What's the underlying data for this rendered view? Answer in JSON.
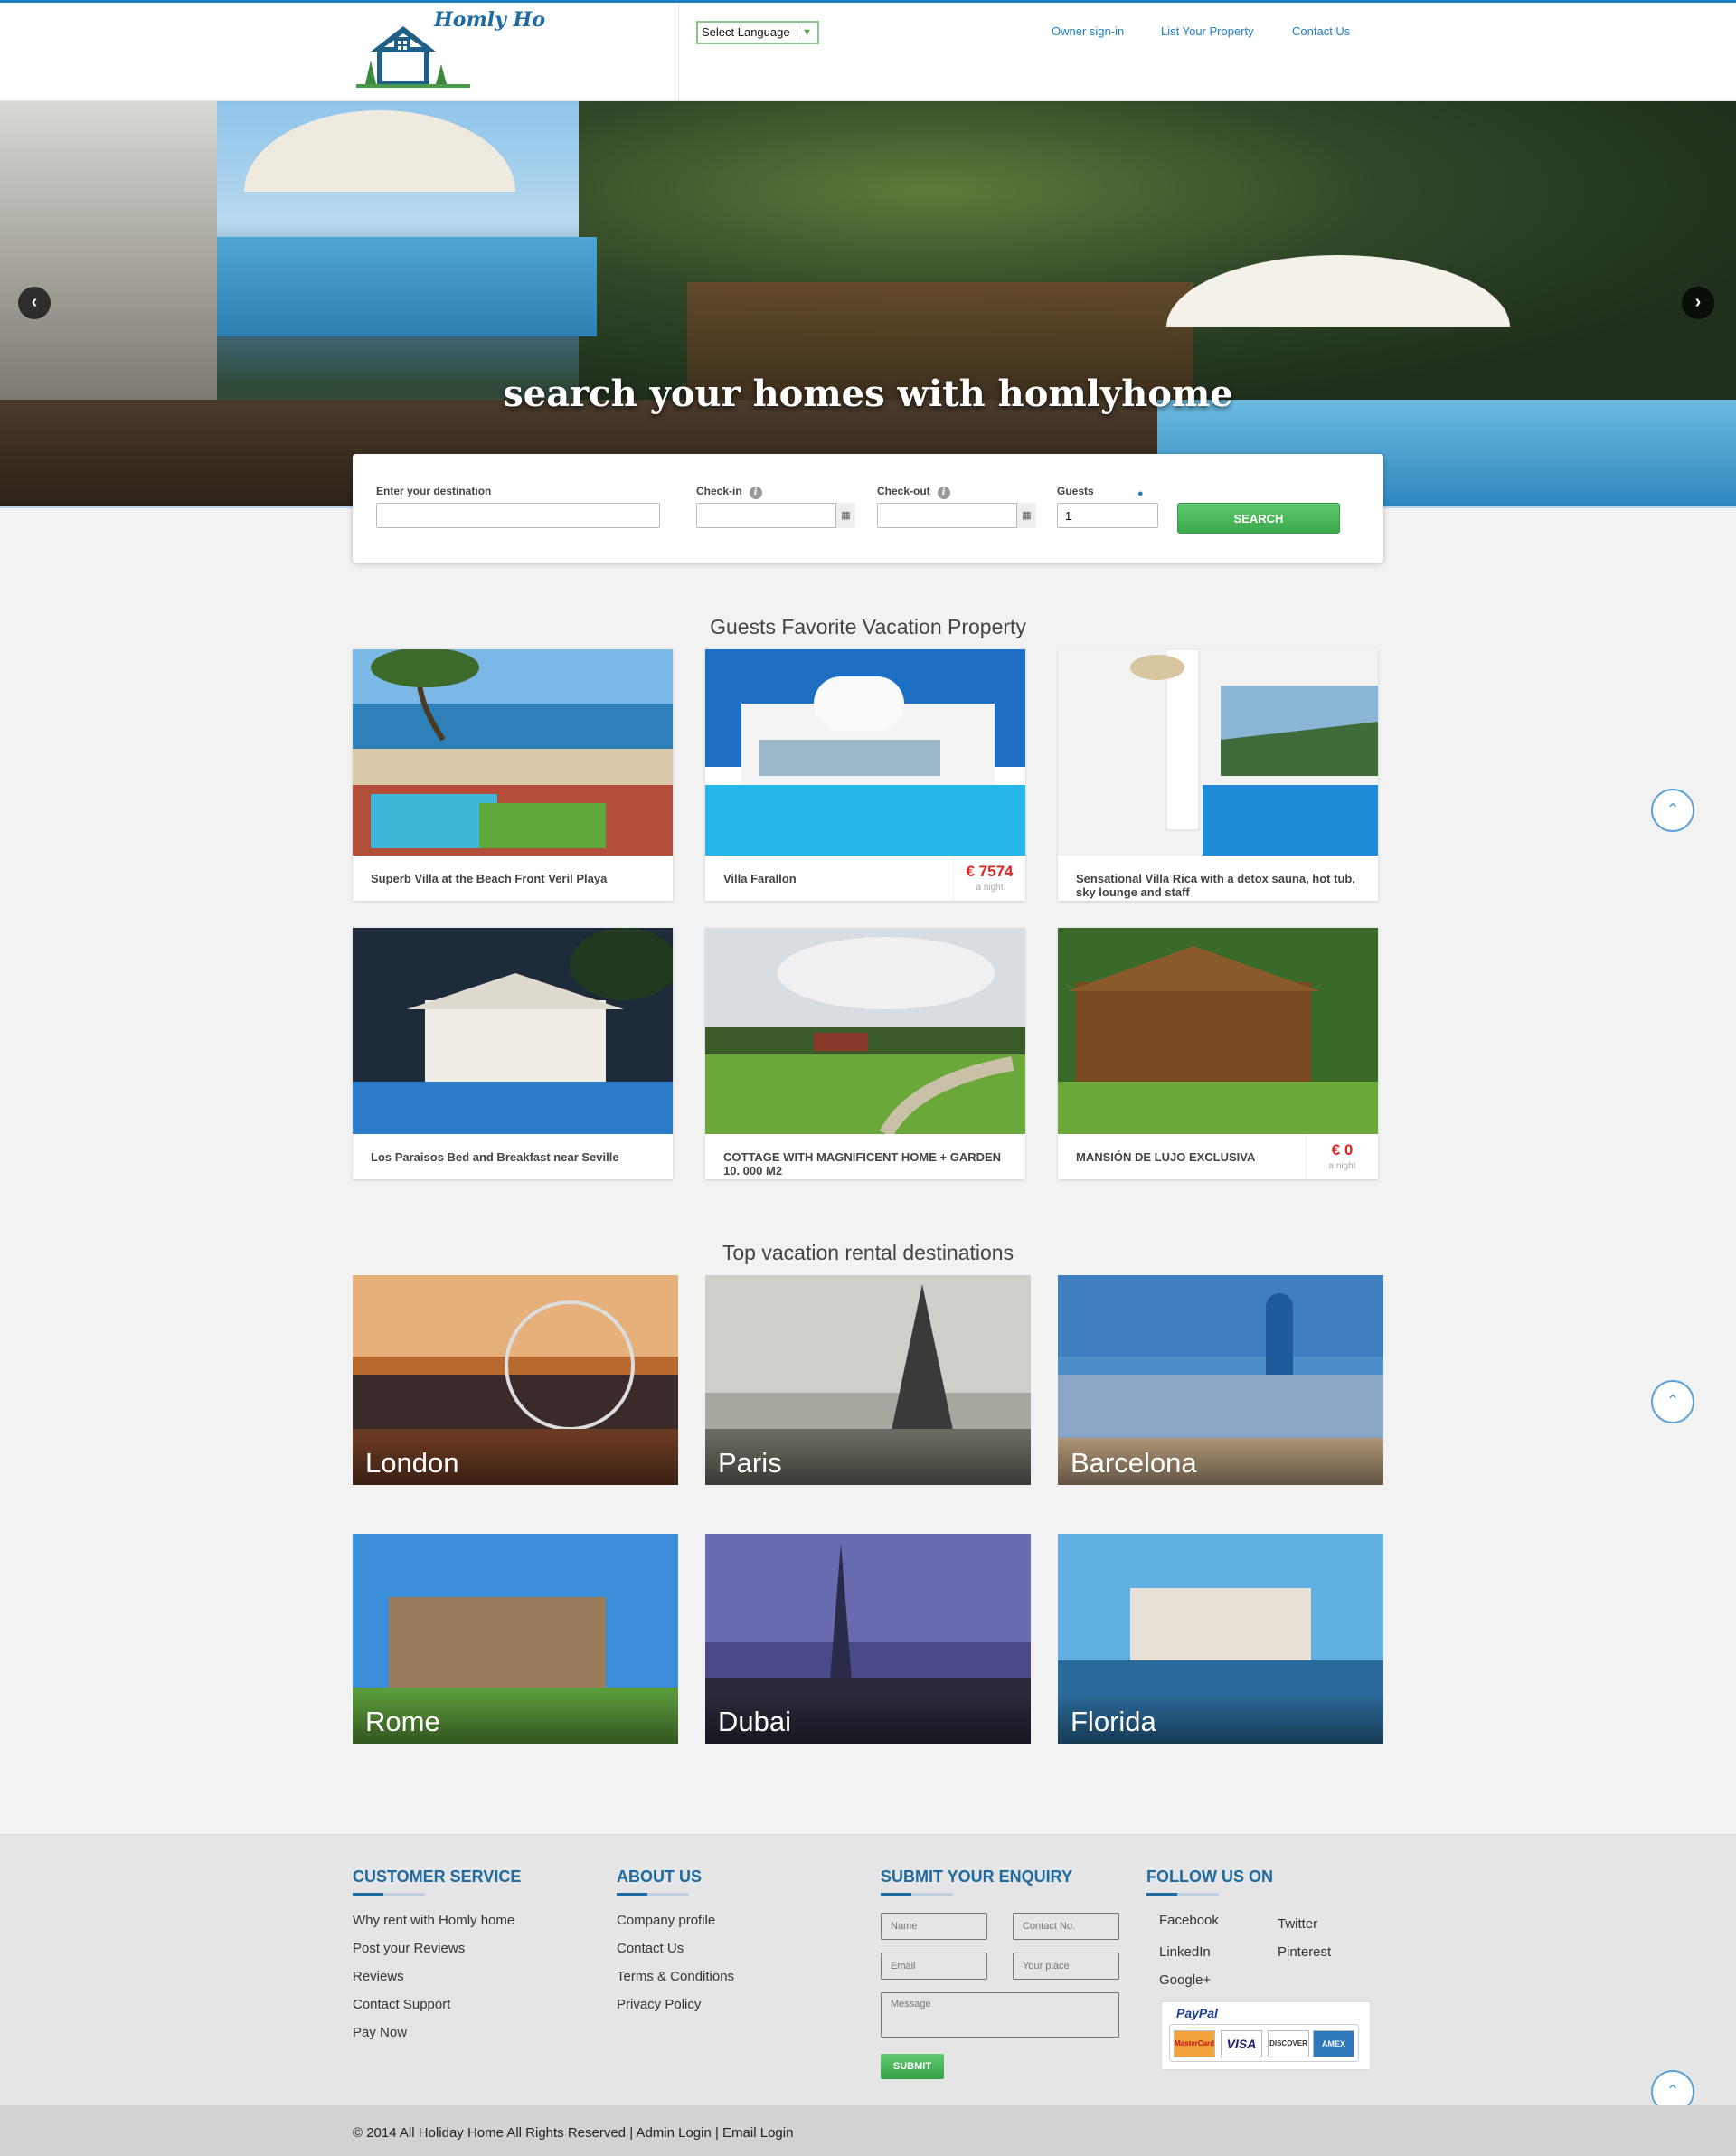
{
  "header": {
    "logo_text": "Homly Ho",
    "language": "Select Language",
    "nav": [
      "Owner sign-in",
      "List Your Property",
      "Contact Us"
    ]
  },
  "hero": {
    "title": "search your homes with homlyhome",
    "prev_icon": "chevron-left-icon",
    "next_icon": "chevron-right-icon"
  },
  "search": {
    "destination_label": "Enter your destination",
    "checkin_label": "Check-in",
    "checkout_label": "Check-out",
    "guests_label": "Guests",
    "guests_value": "1",
    "button": "SEARCH"
  },
  "favorites": {
    "title": "Guests Favorite Vacation Property",
    "properties": [
      {
        "name": "Superb Villa at the Beach Front Veril Playa"
      },
      {
        "name": "Villa Farallon",
        "price": "€ 7574",
        "per": "a night"
      },
      {
        "name": "Sensational Villa Rica with a detox sauna, hot tub, sky lounge and staff"
      },
      {
        "name": "Los Paraisos Bed and Breakfast near Seville"
      },
      {
        "name": "COTTAGE WITH MAGNIFICENT HOME + GARDEN 10. 000 M2"
      },
      {
        "name": "MANSIÓN DE LUJO EXCLUSIVA",
        "price": "€ 0",
        "per": "a night"
      }
    ]
  },
  "destinations": {
    "title": "Top vacation rental destinations",
    "cities": [
      "London",
      "Paris",
      "Barcelona",
      "Rome",
      "Dubai",
      "Florida"
    ]
  },
  "footer": {
    "customer_service": {
      "title": "CUSTOMER SERVICE",
      "links": [
        "Why rent with Homly home",
        "Post your Reviews",
        "Reviews",
        "Contact Support",
        "Pay Now"
      ]
    },
    "about": {
      "title": "ABOUT US",
      "links": [
        "Company profile",
        "Contact Us",
        "Terms & Conditions",
        "Privacy Policy"
      ]
    },
    "enquiry": {
      "title": "SUBMIT YOUR ENQUIRY",
      "name_ph": "Name",
      "contact_ph": "Contact No.",
      "email_ph": "Email",
      "place_ph": "Your place",
      "message_ph": "Message",
      "submit": "SUBMIT"
    },
    "follow": {
      "title": "FOLLOW US ON",
      "links": [
        "Facebook",
        "Twitter",
        "LinkedIn",
        "Pinterest",
        "Google+"
      ],
      "paypal": "PayPal",
      "cards": [
        "MasterCard",
        "VISA",
        "DISCOVER",
        "AMEX"
      ]
    },
    "copyright": "© 2014 All Holiday Home All Rights Reserved | Admin Login | Email Login"
  }
}
